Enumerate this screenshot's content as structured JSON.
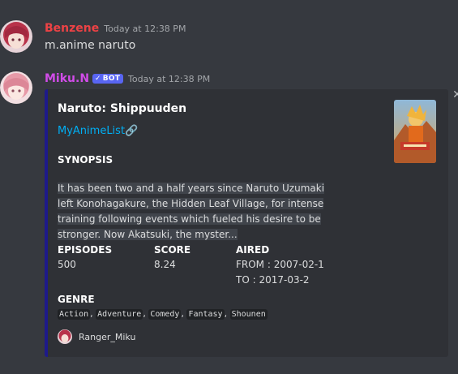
{
  "message1": {
    "username": "Benzene",
    "username_color": "#ed4245",
    "timestamp": "Today at 12:38 PM",
    "content": "m.anime naruto"
  },
  "message2": {
    "username": "Miku.N",
    "username_color": "#d14ce8",
    "badge": "BOT",
    "badge_check": "✓",
    "timestamp": "Today at 12:38 PM"
  },
  "embed": {
    "accent_color": "#1e1a8a",
    "title": "Naruto: Shippuuden",
    "link_text": "MyAnimeList",
    "link_icon": "🔗",
    "close_icon": "✕",
    "synopsis_label": "SYNOPSIS",
    "synopsis": "It has been two and a half years since Naruto Uzumaki left Konohagakure, the Hidden Leaf Village, for intense training following events which fueled his desire to be stronger. Now Akatsuki, the myster...",
    "fields": {
      "episodes_label": "EPISODES",
      "episodes": "500",
      "score_label": "SCORE",
      "score": "8.24",
      "aired_label": "AIRED",
      "aired_from": "FROM : 2007-02-1",
      "aired_to": "TO : 2017-03-2"
    },
    "genre_label": "GENRE",
    "genres": [
      "Action",
      "Adventure",
      "Comedy",
      "Fantasy",
      "Shounen"
    ],
    "footer_text": "Ranger_Miku"
  }
}
